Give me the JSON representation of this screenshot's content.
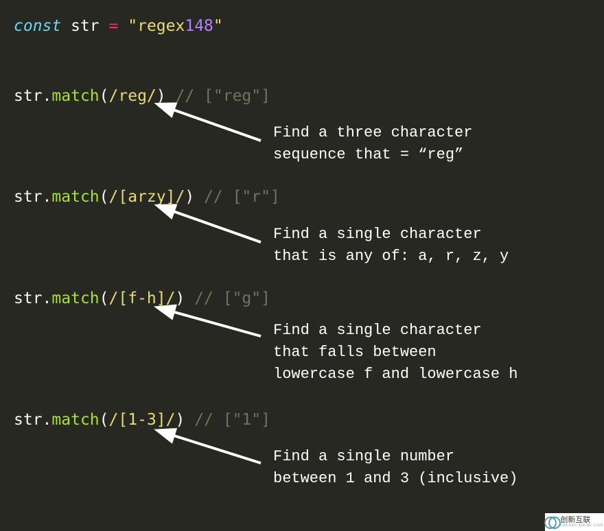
{
  "decl": {
    "keyword": "const",
    "varname": "str",
    "equals": "=",
    "string_open": "\"",
    "string_text": "regex",
    "string_num": "148",
    "string_close": "\""
  },
  "examples": [
    {
      "obj": "str",
      "method": "match",
      "open": "(",
      "slash": "/",
      "pattern": "reg",
      "close_slash": "/",
      "close": ")",
      "comment": " // [\"reg\"]",
      "explain": "Find a three character\nsequence that = “reg”"
    },
    {
      "obj": "str",
      "method": "match",
      "open": "(",
      "slash": "/",
      "pattern": "[arzy]",
      "close_slash": "/",
      "close": ")",
      "comment": " // [\"r\"]",
      "explain": "Find a single character\nthat is any of: a, r, z, y"
    },
    {
      "obj": "str",
      "method": "match",
      "open": "(",
      "slash": "/",
      "pattern": "[f-h]",
      "close_slash": "/",
      "close": ")",
      "comment": " // [\"g\"]",
      "explain": "Find a single character\nthat falls between\nlowercase f and lowercase h"
    },
    {
      "obj": "str",
      "method": "match",
      "open": "(",
      "slash": "/",
      "pattern": "[1-3]",
      "close_slash": "/",
      "close": ")",
      "comment": " // [\"1\"]",
      "explain": "Find a single number\nbetween 1 and 3 (inclusive)"
    }
  ],
  "watermark": {
    "main": "创新互联",
    "sub": "CHUANG XIN HU LIAN"
  }
}
